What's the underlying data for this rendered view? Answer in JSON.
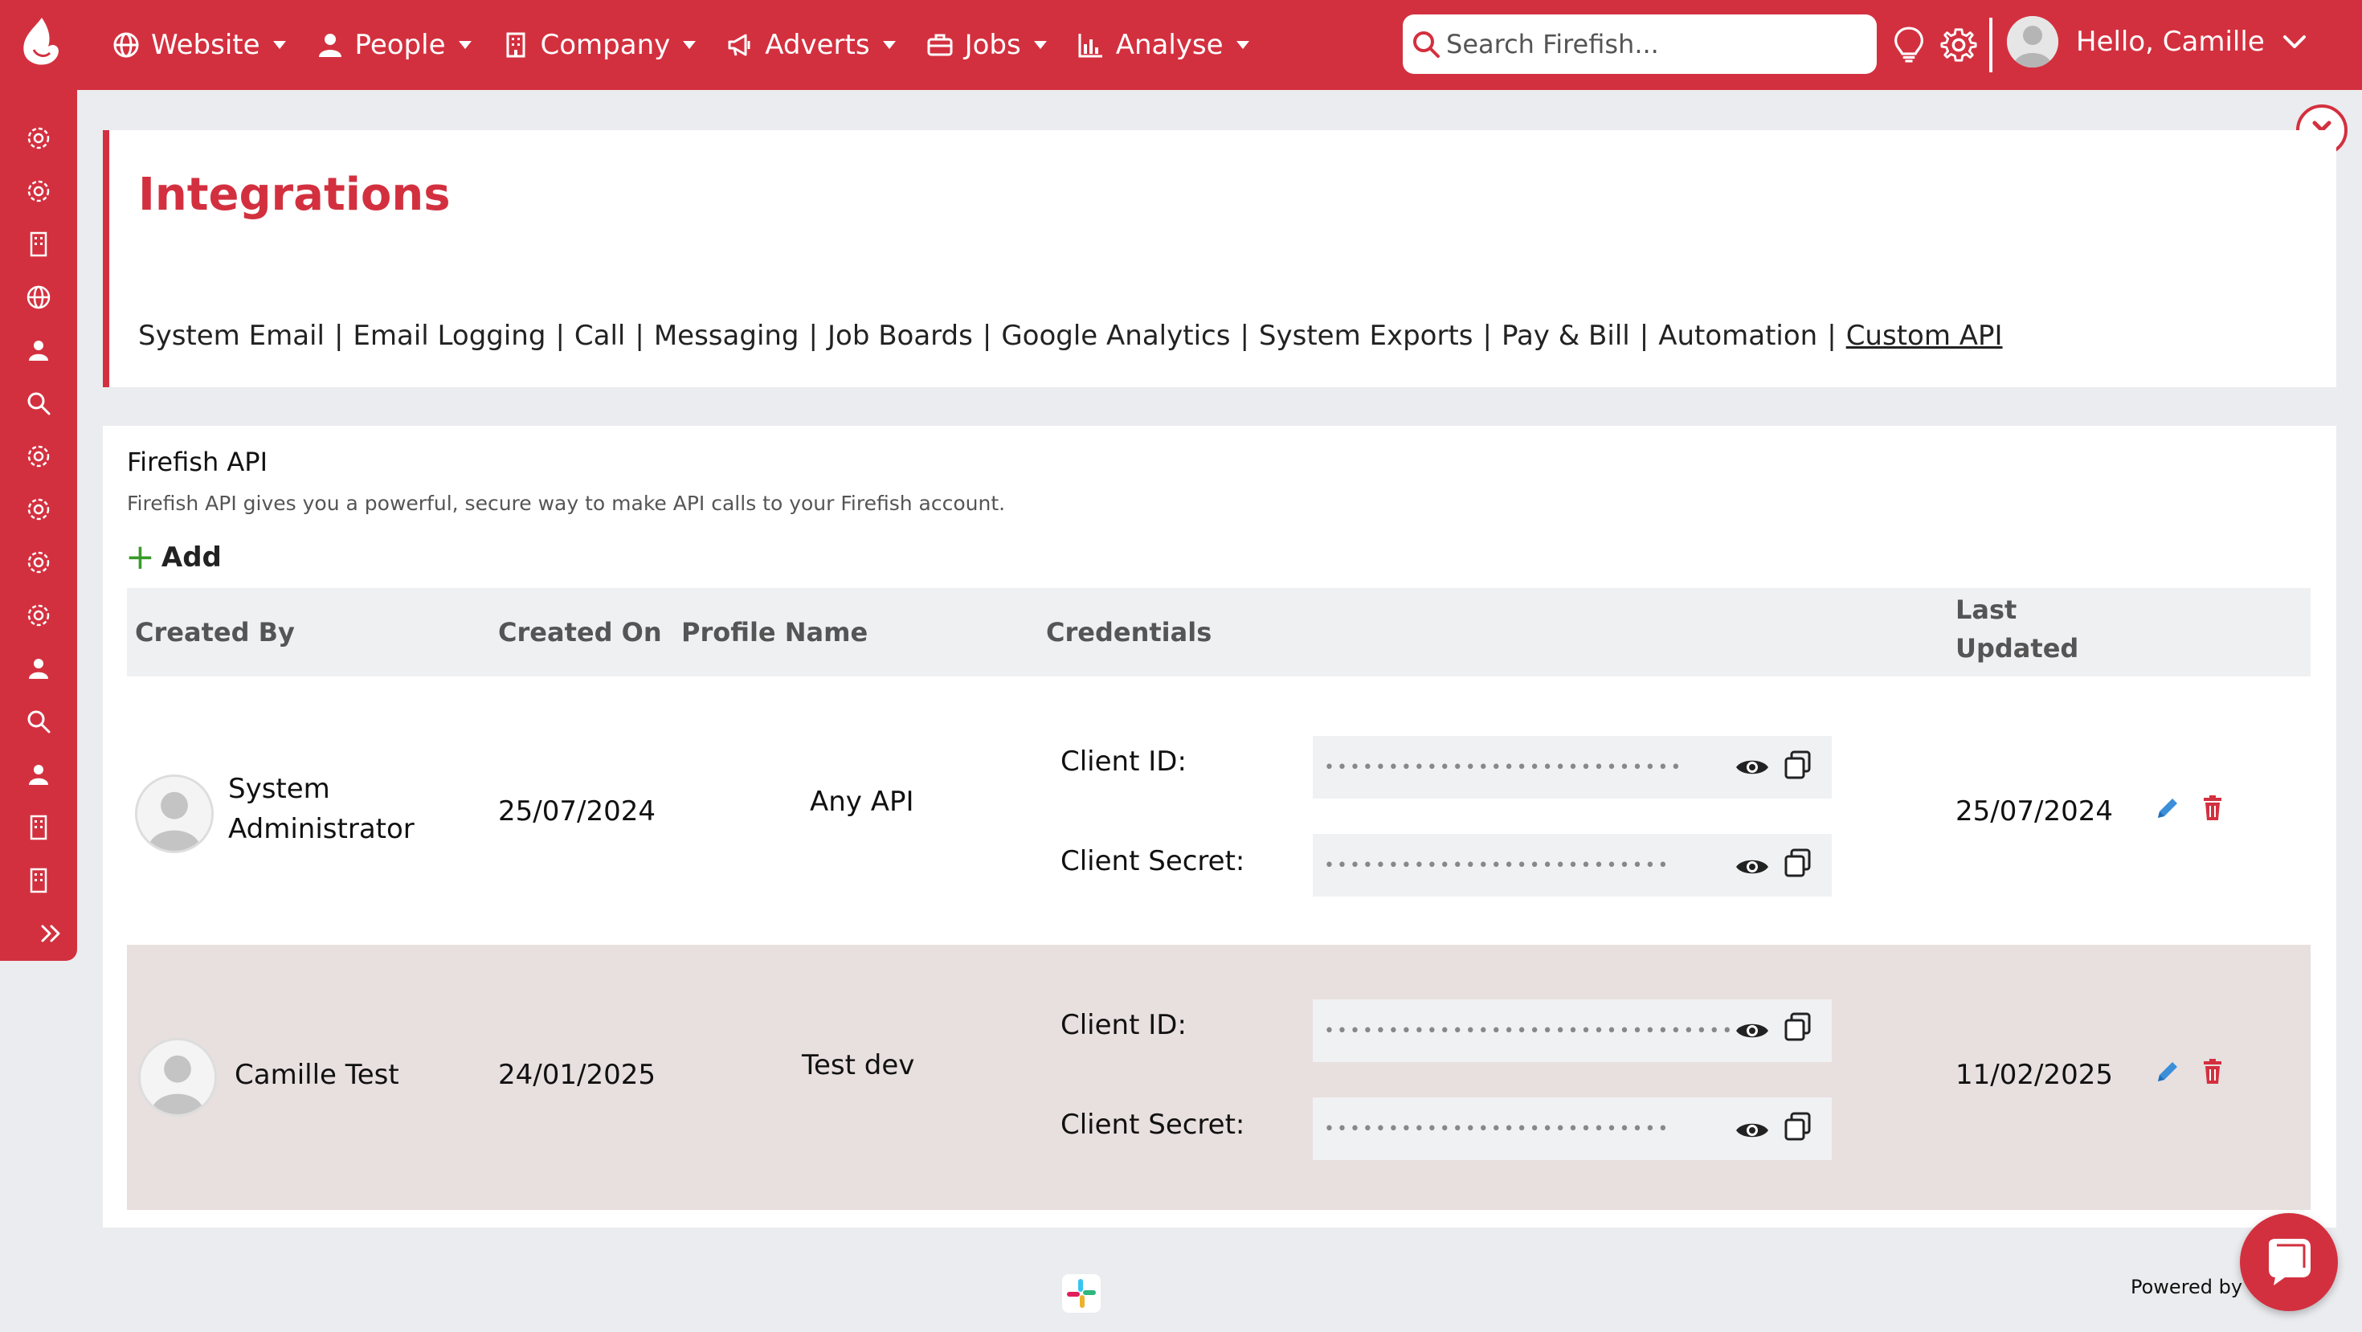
{
  "nav": {
    "items": [
      {
        "label": "Website",
        "icon": "globe-icon"
      },
      {
        "label": "People",
        "icon": "person-icon"
      },
      {
        "label": "Company",
        "icon": "building-icon"
      },
      {
        "label": "Adverts",
        "icon": "megaphone-icon"
      },
      {
        "label": "Jobs",
        "icon": "briefcase-icon"
      },
      {
        "label": "Analyse",
        "icon": "chart-icon"
      }
    ],
    "search_placeholder": "Search Firefish...",
    "greeting": "Hello, Camille"
  },
  "sidebar": {
    "icons": [
      "gear-icon",
      "gear-icon",
      "building-icon",
      "globe-icon",
      "person-icon",
      "search-icon",
      "gear-icon",
      "gear-icon",
      "gear-icon",
      "gear-icon",
      "person-icon",
      "search-icon",
      "person-icon",
      "building-icon",
      "building-icon",
      "expand-icon"
    ]
  },
  "header": {
    "title": "Integrations",
    "tabs": [
      {
        "label": "System Email",
        "active": false
      },
      {
        "label": "Email Logging",
        "active": false
      },
      {
        "label": "Call",
        "active": false
      },
      {
        "label": "Messaging",
        "active": false
      },
      {
        "label": "Job Boards",
        "active": false
      },
      {
        "label": "Google Analytics",
        "active": false
      },
      {
        "label": "System Exports",
        "active": false
      },
      {
        "label": "Pay & Bill",
        "active": false
      },
      {
        "label": "Automation",
        "active": false
      },
      {
        "label": "Custom API",
        "active": true
      }
    ],
    "separator": "|"
  },
  "api": {
    "title": "Firefish API",
    "description": "Firefish API gives you a powerful, secure way to make API calls to your Firefish account.",
    "add_label": "Add"
  },
  "table": {
    "columns": {
      "created_by": "Created By",
      "created_on": "Created On",
      "profile_name": "Profile Name",
      "credentials": "Credentials",
      "last_updated_line1": "Last",
      "last_updated_line2": "Updated"
    },
    "client_id_label": "Client ID:",
    "client_secret_label": "Client Secret:",
    "rows": [
      {
        "created_by_line1": "System",
        "created_by_line2": "Administrator",
        "created_on": "25/07/2024",
        "profile_name": "Any API",
        "client_id_mask": "••••••••••••••••••••••••••••",
        "client_secret_mask": "•••••••••••••••••••••••••••",
        "last_updated": "25/07/2024"
      },
      {
        "created_by_line1": "Camille Test",
        "created_by_line2": "",
        "created_on": "24/01/2025",
        "profile_name": "Test dev",
        "client_id_mask": "••••••••••••••••••••••••••••••••••",
        "client_secret_mask": "•••••••••••••••••••••••••••",
        "last_updated": "11/02/2025"
      }
    ]
  },
  "footer": {
    "powered_by": "Powered by"
  },
  "colors": {
    "brand": "#d3303f",
    "add_plus": "#3a9a2a",
    "edit": "#3b8fd9",
    "delete": "#d3303f",
    "row_highlight": "#e8dfdf"
  }
}
